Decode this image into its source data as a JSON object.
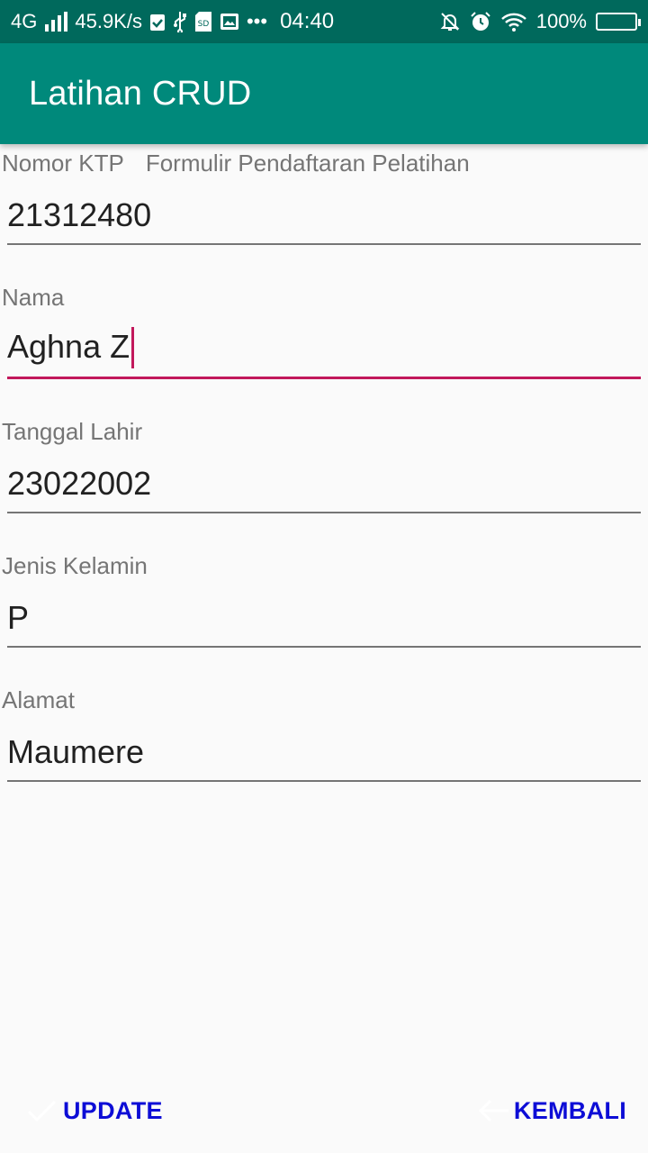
{
  "status_bar": {
    "network": "4G",
    "speed": "45.9K/s",
    "time": "04:40",
    "battery": "100%",
    "dots": "•••",
    "icons": [
      "signal-icon",
      "check-clipboard-icon",
      "usb-icon",
      "sd-card-icon",
      "gallery-icon",
      "bell-off-icon",
      "alarm-icon",
      "wifi-icon",
      "battery-icon"
    ]
  },
  "app_bar": {
    "title": "Latihan CRUD"
  },
  "form": {
    "header_label": "Nomor KTP",
    "header_title": "Formulir Pendaftaran Pelatihan",
    "fields": [
      {
        "label": "Nomor KTP",
        "value": "21312480"
      },
      {
        "label": "Nama",
        "value": "Aghna Z"
      },
      {
        "label": "Tanggal Lahir",
        "value": "23022002"
      },
      {
        "label": "Jenis Kelamin",
        "value": "P"
      },
      {
        "label": "Alamat",
        "value": "Maumere"
      }
    ]
  },
  "actions": {
    "update_label": "UPDATE",
    "back_label": "KEMBALI",
    "update_icon": "check-icon",
    "back_icon": "arrow-left-icon"
  },
  "colors": {
    "status_bar": "#00695c",
    "app_bar": "#00897b",
    "accent": "#c2185b",
    "button_text": "#0d0dd6"
  }
}
